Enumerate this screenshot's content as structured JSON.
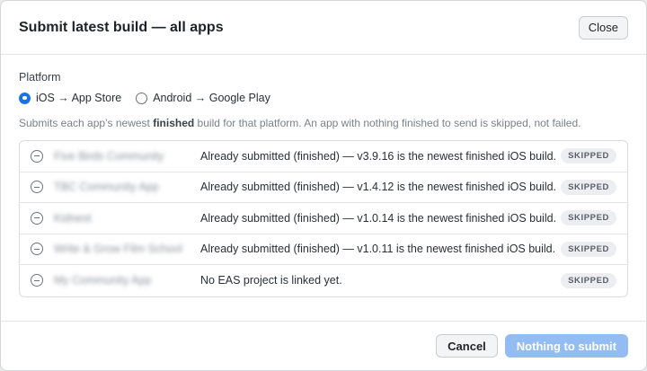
{
  "dialog": {
    "title": "Submit latest build — all apps",
    "close_label": "Close"
  },
  "platform": {
    "label": "Platform",
    "options": [
      {
        "label": "iOS → App Store",
        "selected": true
      },
      {
        "label": "Android → Google Play",
        "selected": false
      }
    ]
  },
  "description": {
    "before": "Submits each app’s newest ",
    "bold": "finished",
    "after": " build for that platform. An app with nothing finished to send is skipped, not failed."
  },
  "apps": [
    {
      "name": "Five Birds Community",
      "message": "Already submitted (finished) — v3.9.16 is the newest finished iOS build.",
      "status": "SKIPPED",
      "icon": "minus-circle-icon"
    },
    {
      "name": "TBC Community App",
      "message": "Already submitted (finished) — v1.4.12 is the newest finished iOS build.",
      "status": "SKIPPED",
      "icon": "minus-circle-icon"
    },
    {
      "name": "Kidnest",
      "message": "Already submitted (finished) — v1.0.14 is the newest finished iOS build.",
      "status": "SKIPPED",
      "icon": "minus-circle-icon"
    },
    {
      "name": "Write & Grow Film School",
      "message": "Already submitted (finished) — v1.0.11 is the newest finished iOS build.",
      "status": "SKIPPED",
      "icon": "minus-circle-icon"
    },
    {
      "name": "My Community App",
      "message": "No EAS project is linked yet.",
      "status": "SKIPPED",
      "icon": "minus-circle-icon"
    }
  ],
  "footer": {
    "cancel_label": "Cancel",
    "submit_label": "Nothing to submit"
  },
  "colors": {
    "accent": "#1a73e8",
    "submit_disabled": "#93bdf2"
  }
}
